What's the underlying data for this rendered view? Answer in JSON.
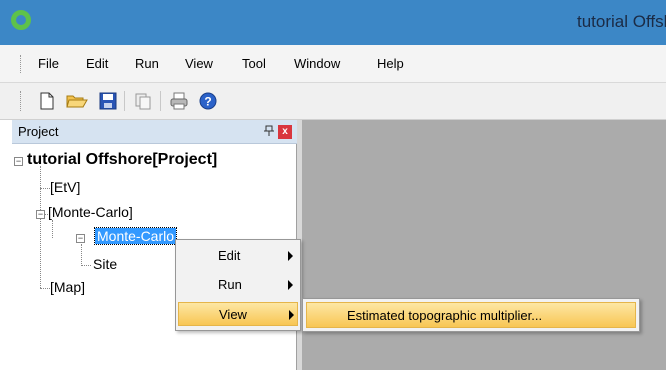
{
  "window": {
    "title": "tutorial Offshore"
  },
  "menubar": {
    "items": [
      "File",
      "Edit",
      "Run",
      "View",
      "Tool",
      "Window",
      "Help"
    ]
  },
  "toolbar": {
    "buttons": [
      "new-file-icon",
      "open-folder-icon",
      "save-icon",
      "copy-icon",
      "print-icon",
      "help-icon"
    ]
  },
  "panel": {
    "title": "Project",
    "pin": "ᵖ",
    "close": "x"
  },
  "tree": {
    "root": "tutorial Offshore[Project]",
    "etv": "[EtV]",
    "monte_carlo_group": "[Monte-Carlo]",
    "monte_carlo_item": "Monte-Carlo",
    "site": "Site",
    "map": "[Map]"
  },
  "context_menu": {
    "items": [
      {
        "label": "Edit",
        "has_submenu": true
      },
      {
        "label": "Run",
        "has_submenu": true
      },
      {
        "label": "View",
        "has_submenu": true,
        "highlighted": true
      }
    ]
  },
  "submenu": {
    "items": [
      {
        "label": "Estimated topographic multiplier...",
        "highlighted": true
      }
    ]
  },
  "colors": {
    "titlebar": "#3c87c6",
    "selection": "#3399ff",
    "menu_highlight": "#f8c654",
    "workspace": "#ababab"
  }
}
